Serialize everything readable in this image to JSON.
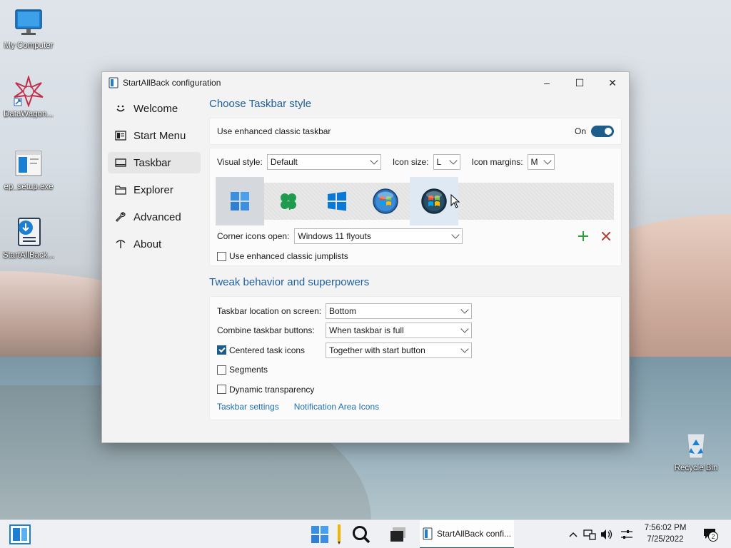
{
  "desktop": {
    "icons": [
      {
        "label": "My Computer"
      },
      {
        "label": "DataWagon..."
      },
      {
        "label": "ep_setup.exe"
      },
      {
        "label": "StartAllBack..."
      },
      {
        "label": "Recycle Bin"
      }
    ]
  },
  "window": {
    "title": "StartAllBack configuration",
    "controls": {
      "minimize": "–",
      "maximize": "☐",
      "close": "✕"
    }
  },
  "sidebar": {
    "items": [
      {
        "label": "Welcome",
        "icon": "smile-icon",
        "active": false
      },
      {
        "label": "Start Menu",
        "icon": "start-menu-icon",
        "active": false
      },
      {
        "label": "Taskbar",
        "icon": "taskbar-icon",
        "active": true
      },
      {
        "label": "Explorer",
        "icon": "folder-icon",
        "active": false
      },
      {
        "label": "Advanced",
        "icon": "wrench-icon",
        "active": false
      },
      {
        "label": "About",
        "icon": "about-icon",
        "active": false
      }
    ]
  },
  "taskbar_style": {
    "heading": "Choose Taskbar style",
    "enhanced_toggle_label": "Use enhanced classic taskbar",
    "enhanced_toggle_state": "On",
    "visual_style_label": "Visual style:",
    "visual_style_value": "Default",
    "icon_size_label": "Icon size:",
    "icon_size_value": "L",
    "icon_margins_label": "Icon margins:",
    "icon_margins_value": "M",
    "styles": [
      "windows-11-logo-icon",
      "clover-icon",
      "windows-10-logo-icon",
      "windows-7-orb-icon",
      "windows-vista-orb-icon"
    ],
    "corner_icons_label": "Corner icons open:",
    "corner_icons_value": "Windows 11 flyouts",
    "jumplists_label": "Use enhanced classic jumplists",
    "jumplists_checked": false
  },
  "tweaks": {
    "heading": "Tweak behavior and superpowers",
    "location_label": "Taskbar location on screen:",
    "location_value": "Bottom",
    "combine_label": "Combine taskbar buttons:",
    "combine_value": "When taskbar is full",
    "centered_label": "Centered task icons",
    "centered_checked": true,
    "centered_value": "Together with start button",
    "segments_label": "Segments",
    "segments_checked": false,
    "transparency_label": "Dynamic transparency",
    "transparency_checked": false,
    "link_taskbar_settings": "Taskbar settings",
    "link_notification_icons": "Notification Area Icons"
  },
  "taskbar": {
    "active_app_label": "StartAllBack confi...",
    "time": "7:56:02 PM",
    "date": "7/25/2022",
    "notification_count": "2"
  },
  "colors": {
    "accent": "#1c5d8a",
    "heading": "#1f5f9e",
    "link": "#1f6fb2",
    "plus": "#2e9e3a",
    "close_x": "#b03a2e"
  }
}
